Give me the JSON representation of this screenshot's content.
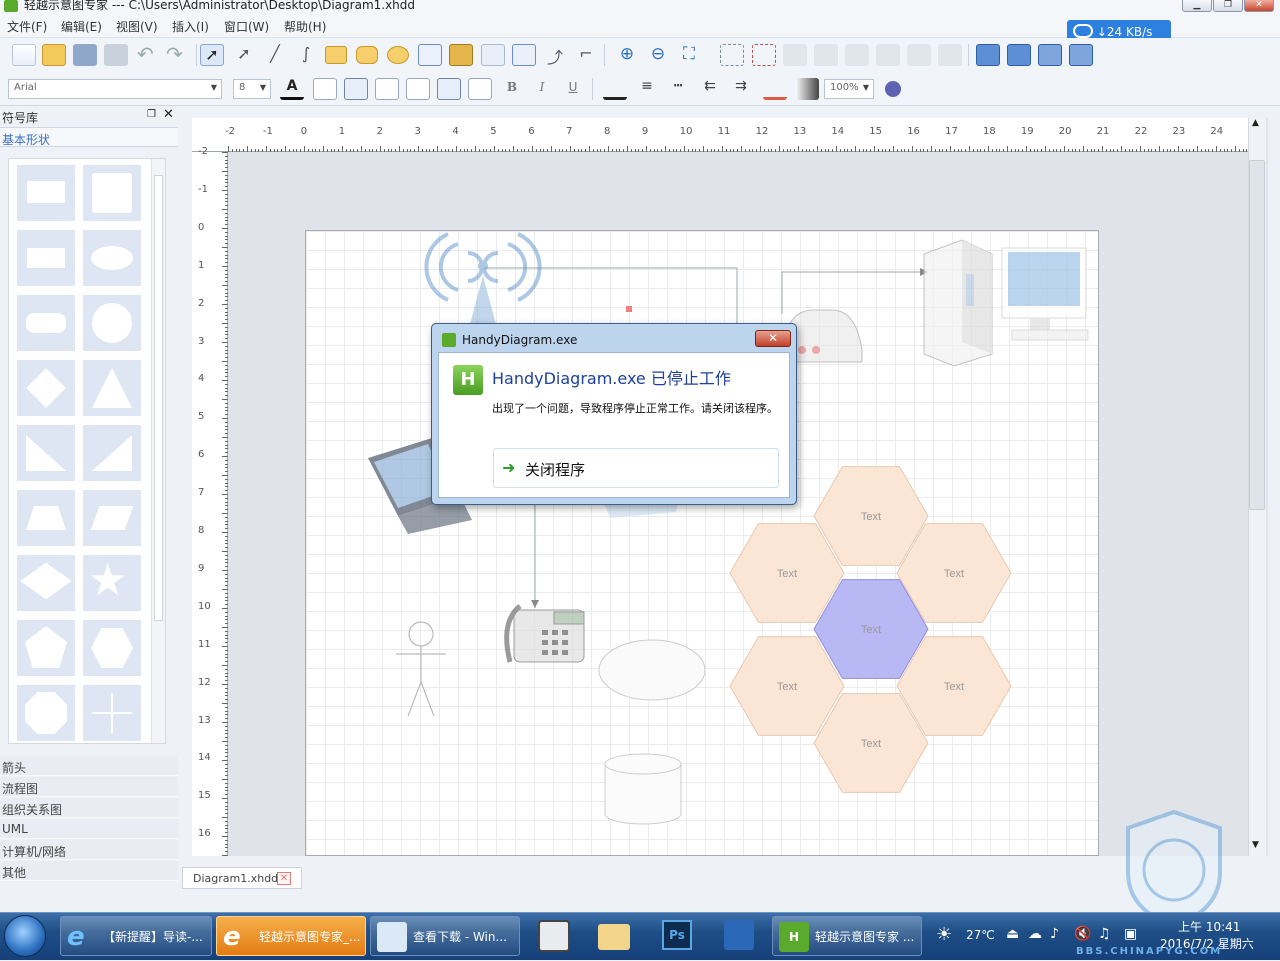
{
  "window": {
    "title": "轻越示意图专家 --- C:\\Users\\Administrator\\Desktop\\Diagram1.xhdd"
  },
  "menu": [
    "文件(F)",
    "编辑(E)",
    "视图(V)",
    "插入(I)",
    "窗口(W)",
    "帮助(H)"
  ],
  "net_speed": "↓24 KB/s",
  "format_bar": {
    "font": "Arial",
    "size": "8",
    "zoom": "100%",
    "bold": "B",
    "italic": "I",
    "underline": "U"
  },
  "left_panel": {
    "title": "符号库",
    "active_category": "基本形状",
    "categories": [
      "箭头",
      "流程图",
      "组织关系图",
      "UML",
      "计算机/网络",
      "其他"
    ]
  },
  "ruler": {
    "h": [
      "-2",
      "-1",
      "0",
      "1",
      "2",
      "3",
      "4",
      "5",
      "6",
      "7",
      "8",
      "9",
      "10",
      "11",
      "12",
      "13",
      "14",
      "15",
      "16",
      "17",
      "18",
      "19",
      "20",
      "21",
      "22",
      "23",
      "24",
      "2"
    ],
    "v": [
      "-2",
      "-1",
      "0",
      "1",
      "2",
      "3",
      "4",
      "5",
      "6",
      "7",
      "8",
      "9",
      "10",
      "11",
      "12",
      "13",
      "14",
      "15",
      "16"
    ]
  },
  "hexagons": [
    "Text",
    "Text",
    "Text",
    "Text",
    "Text",
    "Text",
    "Text"
  ],
  "doc_tab": {
    "label": "Diagram1.xhdd",
    "close": "✕"
  },
  "dialog": {
    "title": "HandyDiagram.exe",
    "heading": "HandyDiagram.exe 已停止工作",
    "message": "出现了一个问题，导致程序停止正常工作。请关闭该程序。",
    "action": "关闭程序",
    "close": "✕"
  },
  "taskbar": {
    "tasks": [
      "【新提醒】导读-...",
      "轻越示意图专家_...",
      "查看下载 - Win...",
      "轻越示意图专家 ..."
    ],
    "weather": "27℃",
    "time": "上午 10:41",
    "date": "2016/7/2 星期六"
  },
  "watermark": {
    "text": "BBS.CHINAPYG.COM"
  },
  "colors": {
    "accent": "#2d7fe0",
    "hex_center": "#b8b8f5",
    "hex_outer": "#fbe6d6"
  }
}
